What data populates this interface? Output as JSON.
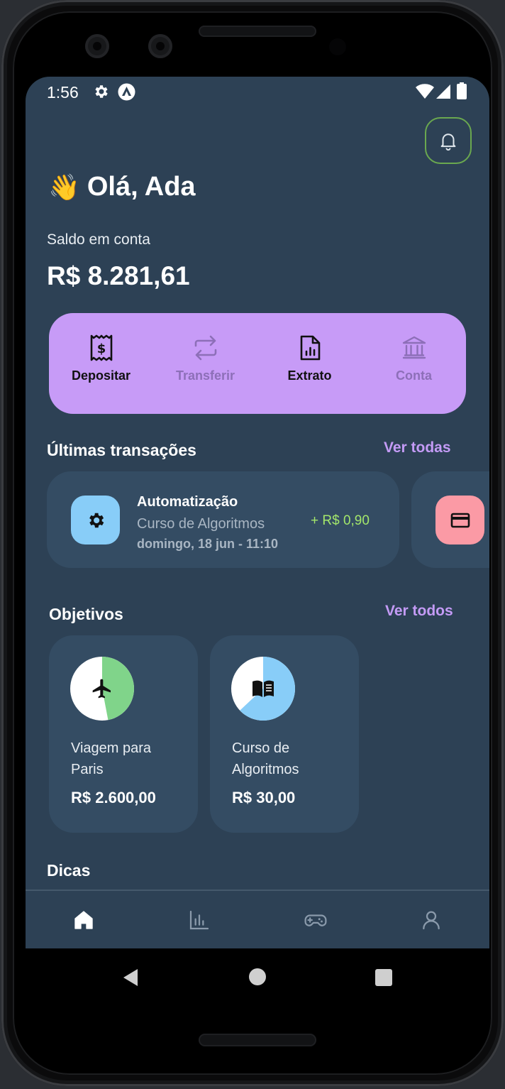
{
  "status": {
    "time": "1:56"
  },
  "greeting": {
    "emoji": "👋",
    "text": "Olá, Ada"
  },
  "balance": {
    "label": "Saldo em conta",
    "value": "R$ 8.281,61"
  },
  "actions": [
    {
      "label": "Depositar",
      "icon": "receipt-dollar-icon",
      "state": "active"
    },
    {
      "label": "Transferir",
      "icon": "transfer-arrows-icon",
      "state": "disabled"
    },
    {
      "label": "Extrato",
      "icon": "statement-chart-icon",
      "state": "active"
    },
    {
      "label": "Conta",
      "icon": "bank-icon",
      "state": "disabled"
    }
  ],
  "transactions": {
    "title": "Últimas transações",
    "see_all": "Ver todas",
    "items": [
      {
        "title": "Automatização",
        "subtitle": "Curso de Algoritmos",
        "date": "domingo, 18 jun - 11:10",
        "amount": "+ R$ 0,90",
        "icon": "gear-icon",
        "icon_color": "#88cdf8"
      },
      {
        "icon": "credit-card-icon",
        "icon_color": "#fb9aa5"
      }
    ]
  },
  "goals": {
    "title": "Objetivos",
    "see_all": "Ver todos",
    "items": [
      {
        "name": "Viagem para Paris",
        "value": "R$ 2.600,00",
        "icon": "airplane-icon",
        "progress": 0.47,
        "color": "#80d48a"
      },
      {
        "name": "Curso de Algoritmos",
        "value": "R$ 30,00",
        "icon": "book-icon",
        "progress": 0.63,
        "color": "#88cdf8"
      }
    ]
  },
  "tips": {
    "title": "Dicas"
  },
  "navbar": [
    {
      "icon": "home-icon",
      "active": true
    },
    {
      "icon": "bar-chart-icon",
      "active": false
    },
    {
      "icon": "gamepad-icon",
      "active": false
    },
    {
      "icon": "user-icon",
      "active": false
    }
  ],
  "colors": {
    "background": "#2d4155",
    "card": "#344c63",
    "accent": "#c79bf7",
    "positive": "#a3e66b"
  }
}
